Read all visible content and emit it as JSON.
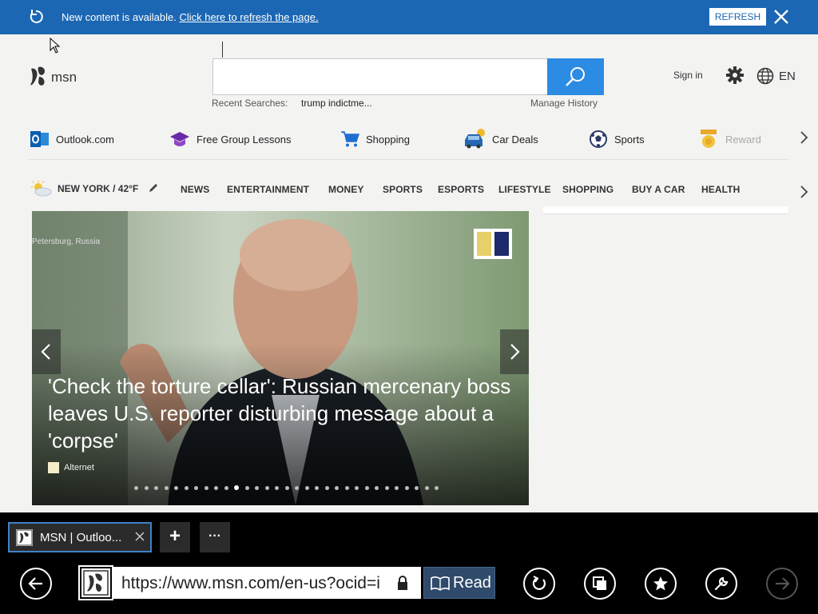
{
  "notification": {
    "message": "New content is available.",
    "link": "Click here to refresh the page.",
    "button": "REFRESH"
  },
  "header": {
    "logo_text": "msn",
    "search_placeholder": "",
    "recent_label": "Recent Searches:",
    "recent_item": "trump indictme...",
    "manage_history": "Manage History",
    "sign_in": "Sign in",
    "language": "EN"
  },
  "quick_links": [
    {
      "label": "Outlook.com",
      "icon": "outlook-icon"
    },
    {
      "label": "Free Group Lessons",
      "icon": "graduation-cap-icon"
    },
    {
      "label": "Shopping",
      "icon": "shopping-cart-icon"
    },
    {
      "label": "Car Deals",
      "icon": "car-icon"
    },
    {
      "label": "Sports",
      "icon": "soccer-ball-icon"
    },
    {
      "label": "Reward",
      "icon": "medal-icon"
    }
  ],
  "nav": {
    "weather": "NEW YORK / 42°F",
    "items": [
      "NEWS",
      "ENTERTAINMENT",
      "MONEY",
      "SPORTS",
      "ESPORTS",
      "LIFESTYLE",
      "SHOPPING",
      "BUY A CAR",
      "HEALTH"
    ]
  },
  "carousel": {
    "location": "Petersburg, Russia",
    "headline": "'Check the torture cellar': Russian mercenary boss leaves U.S. reporter disturbing message about a 'corpse'",
    "source": "Alternet",
    "slide_count": 31,
    "active_slide": 10
  },
  "browser": {
    "tab_title": "MSN | Outloo...",
    "new_tab": "+",
    "more": "···",
    "url": "https://www.msn.com/en-us?ocid=i",
    "read_label": "Read"
  },
  "colors": {
    "notify_bg": "#1c67b3",
    "search_button": "#2c8be2",
    "appbar_bg": "#000000"
  }
}
